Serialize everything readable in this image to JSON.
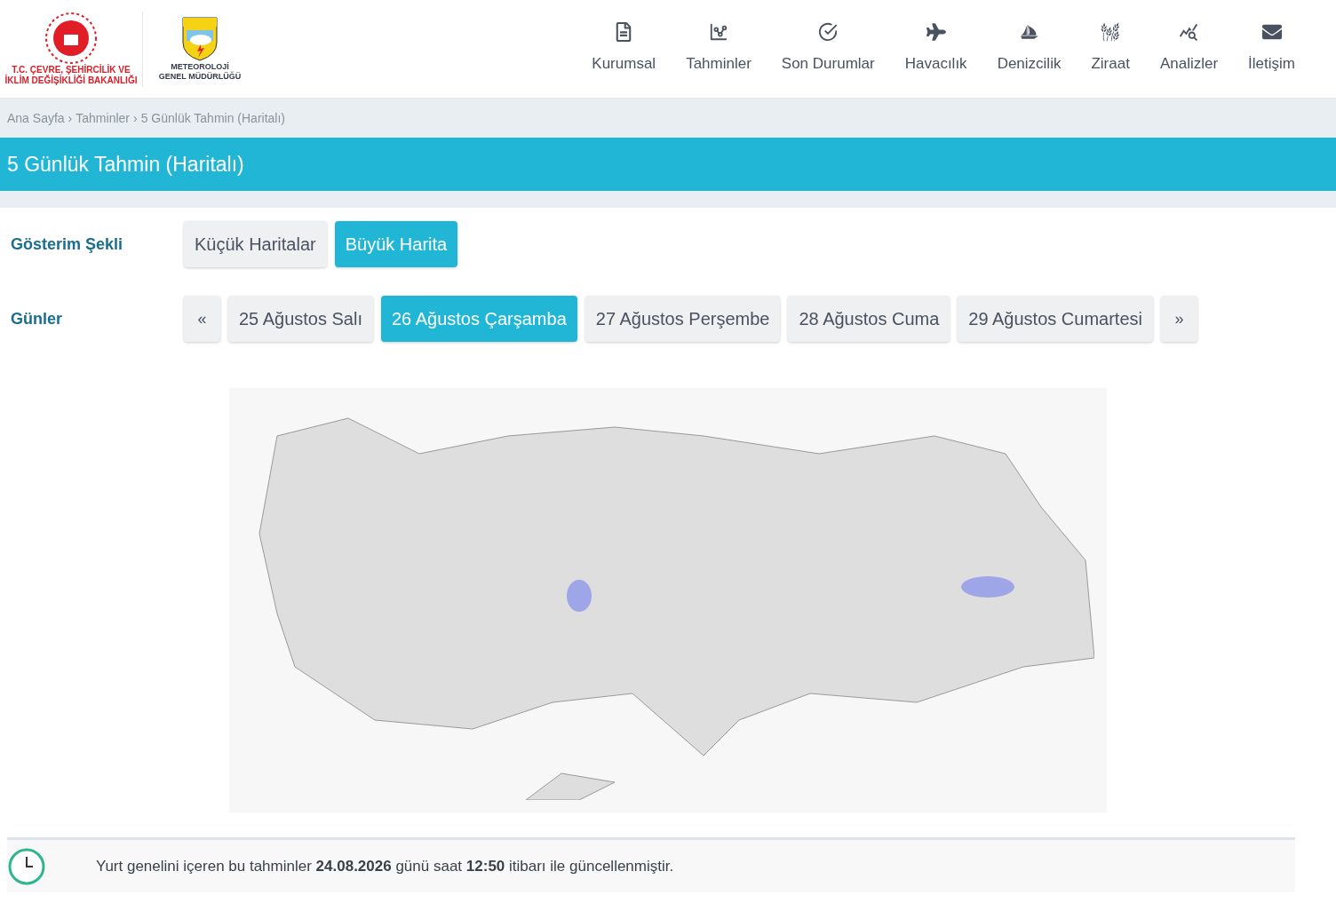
{
  "header": {
    "ministry_logo_text": [
      "T.C. ÇEVRE, ŞEHİRCİLİK VE",
      "İKLİM DEĞİŞİKLİĞİ BAKANLIĞI"
    ],
    "mgm_logo_text": [
      "METEOROLOJİ",
      "GENEL MÜDÜRLÜĞÜ"
    ],
    "nav": [
      {
        "label": "Kurumsal",
        "kind": "doc"
      },
      {
        "label": "Tahminler",
        "kind": "chart"
      },
      {
        "label": "Son Durumlar",
        "kind": "check"
      },
      {
        "label": "Havacılık",
        "kind": "plane"
      },
      {
        "label": "Denizcilik",
        "kind": "sail"
      },
      {
        "label": "Ziraat",
        "kind": "wheat"
      },
      {
        "label": "Analizler",
        "kind": "analysis"
      },
      {
        "label": "İletişim",
        "kind": "mail"
      }
    ]
  },
  "breadcrumb": [
    "Ana Sayfa",
    "Tahminler",
    "5 Günlük Tahmin (Haritalı)"
  ],
  "breadcrumb_separator": "›",
  "page_title": "5 Günlük Tahmin (Haritalı)",
  "display_mode": {
    "label": "Gösterim Şekli",
    "options": [
      {
        "label": "Küçük Haritalar",
        "selected": false
      },
      {
        "label": "Büyük Harita",
        "selected": true
      }
    ]
  },
  "days": {
    "label": "Günler",
    "prev": "«",
    "next": "»",
    "options": [
      {
        "label": "25 Ağustos Salı",
        "selected": false
      },
      {
        "label": "26 Ağustos Çarşamba",
        "selected": true
      },
      {
        "label": "27 Ağustos Perşembe",
        "selected": false
      },
      {
        "label": "28 Ağustos Cuma",
        "selected": false
      },
      {
        "label": "29 Ağustos Cumartesi",
        "selected": false
      }
    ]
  },
  "update_note": "Yurt genelini içeren bu tahminler **24.08.2026** günü saat **12:50** itibarı ile güncellenmiştir."
}
